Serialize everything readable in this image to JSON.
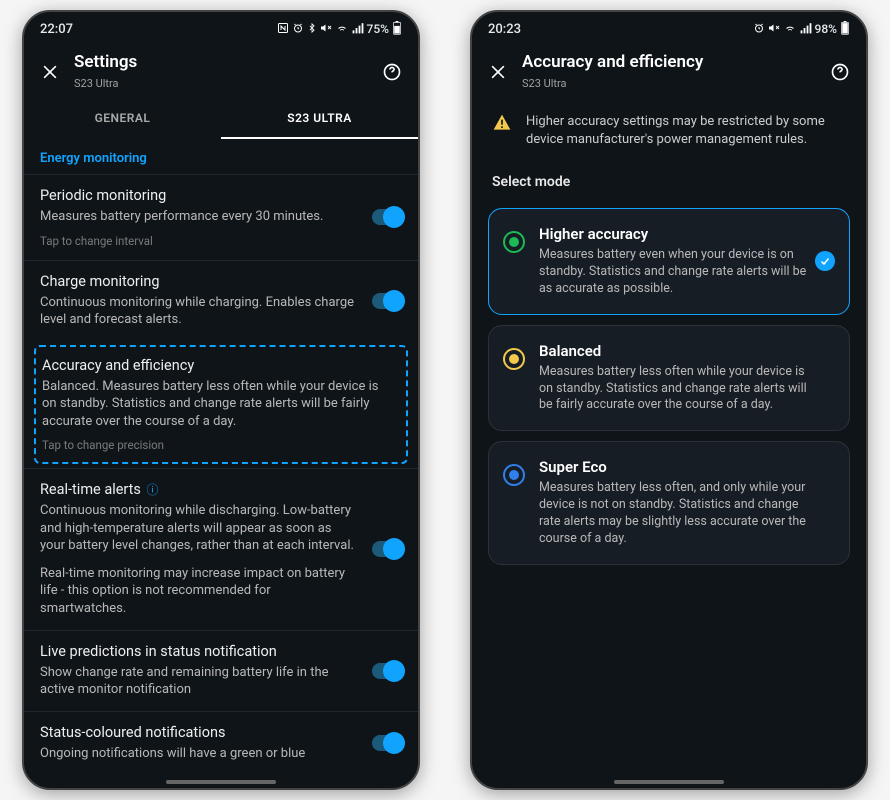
{
  "left": {
    "status": {
      "time": "22:07",
      "battery": "75%"
    },
    "header": {
      "title": "Settings",
      "subtitle": "S23 Ultra"
    },
    "tabs": {
      "general": "GENERAL",
      "device": "S23 ULTRA"
    },
    "section_energy": "Energy monitoring",
    "periodic": {
      "title": "Periodic monitoring",
      "desc": "Measures battery performance every 30 minutes.",
      "hint": "Tap to change interval"
    },
    "charge": {
      "title": "Charge monitoring",
      "desc": "Continuous monitoring while charging. Enables charge level and forecast alerts."
    },
    "accuracy": {
      "title": "Accuracy and efficiency",
      "desc": "Balanced. Measures battery less often while your device is on standby. Statistics and change rate alerts will be fairly accurate over the course of a day.",
      "hint": "Tap to change precision"
    },
    "realtime": {
      "title": "Real-time alerts",
      "desc": "Continuous monitoring while discharging. Low-battery and high-temperature alerts will appear as soon as your battery level changes, rather than at each interval.",
      "desc2": "Real-time monitoring may increase impact on battery life - this option is not recommended for smartwatches."
    },
    "live_pred": {
      "title": "Live predictions in status notification",
      "desc": "Show change rate and remaining battery life in the active monitor notification"
    },
    "status_color": {
      "title": "Status-coloured notifications",
      "desc": "Ongoing notifications will have a green or blue"
    }
  },
  "right": {
    "status": {
      "time": "20:23",
      "battery": "98%"
    },
    "header": {
      "title": "Accuracy and efficiency",
      "subtitle": "S23 Ultra"
    },
    "warning": "Higher accuracy settings may be restricted by some device manufacturer's power management rules.",
    "section": "Select mode",
    "higher": {
      "title": "Higher accuracy",
      "desc": "Measures battery even when your device is on standby. Statistics and change rate alerts will be as accurate as possible."
    },
    "balanced": {
      "title": "Balanced",
      "desc": "Measures battery less often while your device is on standby. Statistics and change rate alerts will be fairly accurate over the course of a day."
    },
    "eco": {
      "title": "Super Eco",
      "desc": "Measures battery less often, and only while your device is not on standby. Statistics and change rate alerts may be slightly less accurate over the course of a day."
    }
  },
  "colors": {
    "accent": "#11a4ff",
    "ring_green": "#1db954",
    "ring_yellow": "#f2c94c",
    "ring_blue": "#2f80ed"
  }
}
